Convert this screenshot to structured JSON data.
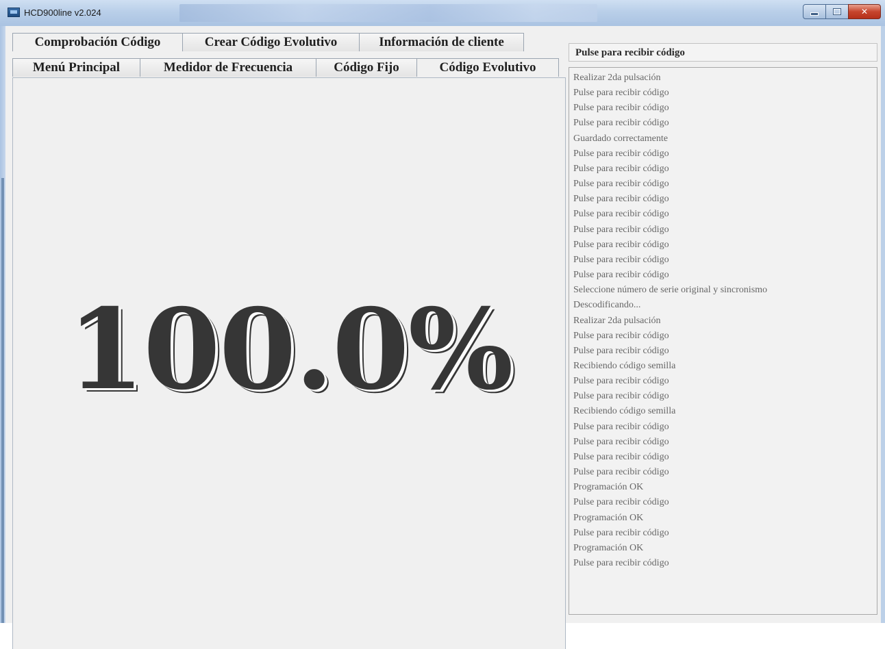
{
  "window": {
    "title": "HCD900line  v2.024"
  },
  "tabs": {
    "top_row": [
      "Comprobación Código",
      "Crear Código Evolutivo",
      "Información de cliente"
    ],
    "bottom_row": [
      "Menú Principal",
      "Medidor de Frecuencia",
      "Código Fijo",
      "Código Evolutivo"
    ]
  },
  "main": {
    "progress_text": "100.0%",
    "progress_value": 1.0
  },
  "status": {
    "current": "Pulse para recibir código"
  },
  "log": [
    "Realizar 2da pulsación",
    "Pulse para recibir código",
    "Pulse para recibir código",
    "Pulse para recibir código",
    "Guardado correctamente",
    "Pulse para recibir código",
    "Pulse para recibir código",
    "Pulse para recibir código",
    "Pulse para recibir código",
    "Pulse para recibir código",
    "Pulse para recibir código",
    "Pulse para recibir código",
    "Pulse para recibir código",
    "Pulse para recibir código",
    "Seleccione número de serie original y sincronismo",
    "Descodificando...",
    "Realizar 2da pulsación",
    "Pulse para recibir código",
    "Pulse para recibir código",
    "Recibiendo código semilla",
    "Pulse para recibir código",
    "Pulse para recibir código",
    "Recibiendo código semilla",
    "Pulse para recibir código",
    "Pulse para recibir código",
    "Pulse para recibir código",
    "Pulse para recibir código",
    "Programación OK",
    "Pulse para recibir código",
    "Programación OK",
    "Pulse para recibir código",
    "Programación OK",
    "Pulse para recibir código"
  ]
}
